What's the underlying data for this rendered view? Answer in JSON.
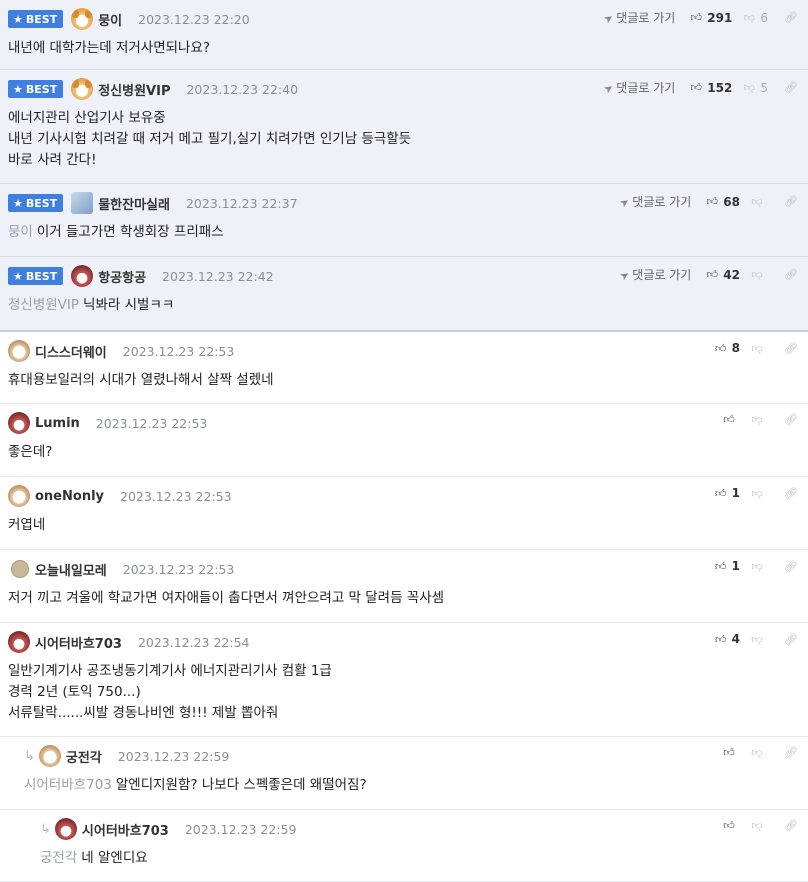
{
  "ui": {
    "best_label": "BEST",
    "goto_label": "댓글로 가기"
  },
  "comments": [
    {
      "id": "c1",
      "best": true,
      "avatar": "dog",
      "author": "뭉이",
      "time": "2023.12.23 22:20",
      "up": "291",
      "down": "6",
      "show_goto": true,
      "mention": "",
      "lines": [
        "내년에 대학가는데 저거사면되나요?"
      ]
    },
    {
      "id": "c2",
      "best": true,
      "avatar": "dog",
      "author": "정신병원VIP",
      "time": "2023.12.23 22:40",
      "up": "152",
      "down": "5",
      "show_goto": true,
      "mention": "",
      "lines": [
        "에너지관리 산업기사 보유중",
        "내년 기사시험 치려갈 때 저거 메고 필기,실기 치려가면 인기남 등극할듯",
        "바로 사려 간다!"
      ]
    },
    {
      "id": "c3",
      "best": true,
      "avatar": "robot",
      "author": "물한잔마실래",
      "time": "2023.12.23 22:37",
      "up": "68",
      "down": "",
      "show_goto": true,
      "mention": "뭉이",
      "lines": [
        "이거 들고가면 학생회장 프리패스"
      ]
    },
    {
      "id": "c4",
      "best": true,
      "avatar": "pig",
      "author": "항공항공",
      "time": "2023.12.23 22:42",
      "up": "42",
      "down": "",
      "show_goto": true,
      "mention": "정신병원VIP",
      "lines": [
        "닉봐라 시벌ㅋㅋ"
      ]
    },
    {
      "id": "c5",
      "best": false,
      "avatar": "puppy",
      "author": "디스스더웨이",
      "time": "2023.12.23 22:53",
      "up": "8",
      "down": "",
      "show_goto": false,
      "mention": "",
      "lines": [
        "휴대용보일러의 시대가 열렸나해서 살짝 설렜네"
      ]
    },
    {
      "id": "c6",
      "best": false,
      "avatar": "pig",
      "author": "Lumin",
      "time": "2023.12.23 22:53",
      "up": "",
      "down": "",
      "show_goto": false,
      "mention": "",
      "lines": [
        "좋은데?"
      ]
    },
    {
      "id": "c7",
      "best": false,
      "avatar": "puppy",
      "author": "oneNonly",
      "time": "2023.12.23 22:53",
      "up": "1",
      "down": "",
      "show_goto": false,
      "mention": "",
      "lines": [
        "커엽네"
      ]
    },
    {
      "id": "c8",
      "best": false,
      "avatar": "dot",
      "author": "오늘내일모레",
      "time": "2023.12.23 22:53",
      "up": "1",
      "down": "",
      "show_goto": false,
      "mention": "",
      "lines": [
        "저거 끼고 겨울에 학교가면 여자애들이 춥다면서 껴안으려고 막 달려듬 꼭사셈"
      ]
    },
    {
      "id": "c9",
      "best": false,
      "avatar": "pig",
      "author": "시어터바흐703",
      "time": "2023.12.23 22:54",
      "up": "4",
      "down": "",
      "show_goto": false,
      "mention": "",
      "lines": [
        "일반기계기사 공조냉동기계기사 에너지관리기사 컴활 1급",
        "경력 2년 (토익 750...)",
        "서류탈락......씨발 경동나비엔 형!!! 제발 뽑아줘"
      ]
    },
    {
      "id": "c10",
      "best": false,
      "avatar": "puppy",
      "author": "궁전각",
      "time": "2023.12.23 22:59",
      "up": "",
      "down": "",
      "show_goto": false,
      "mention": "시어터바흐703",
      "lines": [
        "알엔디지원함? 나보다 스펙좋은데 왜떨어짐?"
      ]
    },
    {
      "id": "c11",
      "best": false,
      "avatar": "pig",
      "author": "시어터바흐703",
      "time": "2023.12.23 22:59",
      "up": "",
      "down": "",
      "show_goto": false,
      "mention": "궁전각",
      "lines": [
        "네 알엔디요"
      ]
    }
  ]
}
